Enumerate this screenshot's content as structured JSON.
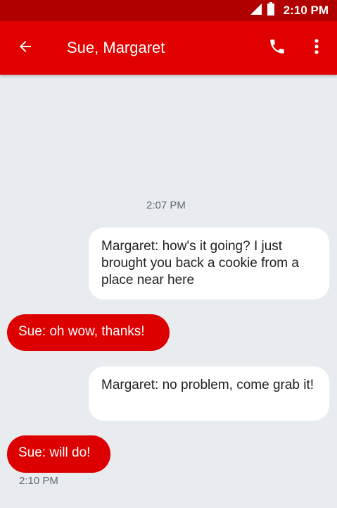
{
  "status_bar": {
    "time": "2:10 PM",
    "icons": [
      "signal-icon",
      "battery-icon"
    ]
  },
  "app_bar": {
    "title": "Sue, Margaret",
    "icons": [
      "back-arrow-icon",
      "phone-icon",
      "more-vert-icon"
    ]
  },
  "conversation": {
    "timestamp_top": "2:07 PM",
    "messages": [
      {
        "direction": "incoming",
        "text": "Margaret: how's it going? I just brought you back a cookie from a place near here"
      },
      {
        "direction": "outgoing",
        "text": "Sue: oh wow, thanks!"
      },
      {
        "direction": "incoming",
        "text": "Margaret: no problem, come grab it!"
      },
      {
        "direction": "outgoing",
        "text": "Sue: will do!"
      }
    ],
    "timestamp_bottom": "2:10 PM"
  },
  "colors": {
    "status_bar": "#b00000",
    "app_bar": "#e00000",
    "outgoing_bubble": "#dd0000",
    "incoming_bubble": "#ffffff",
    "background": "#e9ecef",
    "timestamp": "#5f6b75"
  }
}
